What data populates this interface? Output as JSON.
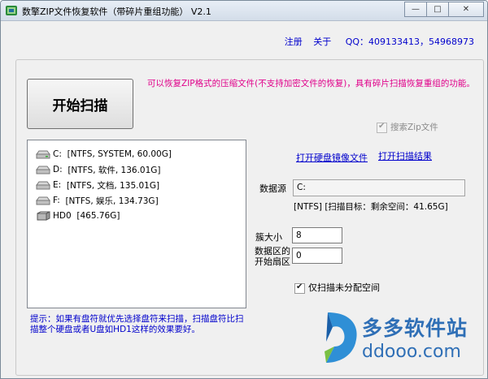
{
  "window": {
    "title": "数擎ZIP文件恢复软件（带碎片重组功能） V2.1",
    "minimize_glyph": "—",
    "maximize_glyph": "□",
    "close_glyph": "✕"
  },
  "header": {
    "register": "注册",
    "about": "关于",
    "qq": "QQ：409133413，54968973"
  },
  "main": {
    "start_button": "开始扫描",
    "description": "可以恢复ZIP格式的压缩文件(不支持加密文件的恢复)，具有碎片扫描恢复重组的功能。",
    "search_zip_label": "搜索Zip文件",
    "search_zip_checked": true,
    "open_image_link": "打开硬盘镜像文件",
    "open_results_link": "打开扫描结果"
  },
  "drives": [
    {
      "name": "C:",
      "info": "[NTFS, SYSTEM, 60.00G]"
    },
    {
      "name": "D:",
      "info": "[NTFS, 软件, 136.01G]"
    },
    {
      "name": "E:",
      "info": "[NTFS, 文档, 135.01G]"
    },
    {
      "name": "F:",
      "info": "[NTFS, 娱乐, 134.73G]"
    },
    {
      "name": "HD0",
      "info": "[465.76G]"
    }
  ],
  "source": {
    "label": "数据源",
    "value": "C:",
    "info": "[NTFS]  [扫描目标：剩余空间：41.65G]"
  },
  "cluster": {
    "label": "簇大小",
    "value": "8"
  },
  "start_sector": {
    "label_line1": "数据区的",
    "label_line2": "开始扇区",
    "value": "0"
  },
  "unallocated": {
    "label": "仅扫描未分配空间",
    "checked": true
  },
  "tip": "提示：如果有盘符就优先选择盘符来扫描，扫描盘符比扫描整个硬盘或者U盘如HD1这样的效果要好。",
  "watermark": {
    "text": "多多软件站",
    "url": "ddooo.com"
  },
  "colors": {
    "link": "#0000cc",
    "description": "#e0008a",
    "watermark": "#2f6fb6"
  }
}
